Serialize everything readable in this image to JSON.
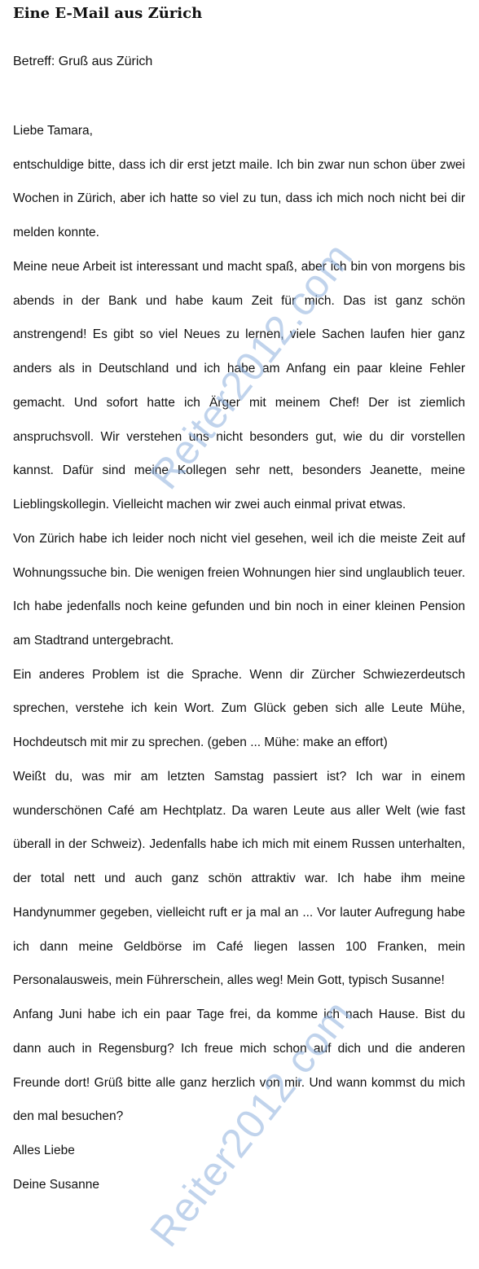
{
  "document": {
    "title": "Eine E-Mail aus Zürich",
    "subject": "Betreff: Gruß aus Zürich",
    "paragraphs": [
      "Liebe Tamara,",
      "entschuldige bitte, dass ich dir erst jetzt maile. Ich bin zwar nun schon über zwei Wochen in Zürich, aber ich hatte so viel zu tun, dass ich mich noch nicht bei dir melden konnte.",
      "Meine neue Arbeit ist interessant und macht spaß, aber ich bin von morgens bis abends in der Bank und habe kaum Zeit für mich. Das ist ganz schön anstrengend! Es gibt so viel Neues zu lernen, viele Sachen laufen hier ganz anders als in Deutschland und ich habe am Anfang ein paar kleine Fehler gemacht. Und sofort hatte ich Ärger mit meinem Chef! Der ist ziemlich anspruchsvoll. Wir verstehen uns nicht besonders gut, wie du dir vorstellen kannst. Dafür sind meine Kollegen sehr nett, besonders Jeanette, meine Lieblingskollegin. Vielleicht machen wir zwei auch einmal privat etwas.",
      "Von Zürich habe ich leider noch nicht viel gesehen, weil ich die meiste Zeit auf Wohnungssuche bin. Die wenigen freien Wohnungen hier sind unglaublich teuer. Ich habe jedenfalls noch keine gefunden und bin noch in einer kleinen Pension am Stadtrand untergebracht.",
      "Ein anderes Problem ist die Sprache. Wenn dir Zürcher Schwiezerdeutsch sprechen, verstehe ich kein Wort. Zum Glück geben sich alle Leute Mühe, Hochdeutsch mit mir zu sprechen. (geben ... Mühe: make an effort)",
      "Weißt du, was mir am letzten Samstag passiert ist? Ich war in einem wunderschönen Café am Hechtplatz. Da waren Leute aus aller Welt (wie fast überall in der Schweiz). Jedenfalls habe ich mich mit einem Russen unterhalten, der total nett und auch ganz schön attraktiv war. Ich habe ihm meine Handynummer gegeben, vielleicht ruft er ja mal an ... Vor lauter Aufregung habe ich dann meine Geldbörse im Café liegen lassen 100 Franken, mein Personalausweis, mein Führerschein, alles weg! Mein Gott, typisch Susanne!",
      "Anfang Juni habe ich ein paar Tage frei, da komme ich nach Hause. Bist du dann auch in Regensburg? Ich freue mich schon auf dich und die anderen Freunde dort! Grüß bitte alle ganz herzlich von mir. Und wann kommst du mich den mal besuchen?",
      "Alles Liebe",
      "Deine Susanne"
    ]
  },
  "watermark": {
    "text": "Reiter2012.com",
    "color": "#8cafdc"
  }
}
